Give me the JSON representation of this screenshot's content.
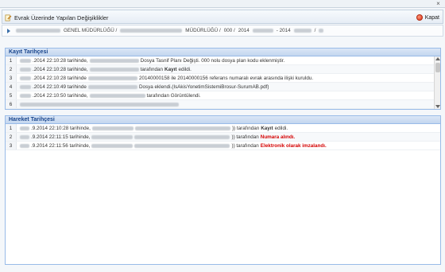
{
  "window": {
    "close_glyph": "×"
  },
  "toolbar": {
    "title": "Evrak Üzerinde Yapılan Değişiklikler",
    "close_label": "Kapat"
  },
  "breadcrumb": {
    "part1": "GENEL MÜDÜRLÜĞÜ /",
    "part2": "MÜDÜRLÜĞÜ /",
    "part3": "000 /",
    "part4": "2014",
    "part5": "- 2014",
    "part6": "/"
  },
  "kayit": {
    "header": "Kayıt Tarihçesi",
    "rows": [
      {
        "n": "1",
        "date": ".2014 22:10:28 tarihinde,",
        "rest": "Dosya Tasnif Planı Değişti. 000 nolu dosya plan kodu eklenmiştir."
      },
      {
        "n": "2",
        "date": ".2014 22:10:28 tarihinde,",
        "pre": "tarafından",
        "bold": "Kayıt",
        "post": "edildi."
      },
      {
        "n": "3",
        "date": ".2014 22:10:28 tarihinde",
        "rest": "20140000158 ile 20140000156 referans numaralı evrak arasında ilişki kuruldu."
      },
      {
        "n": "4",
        "date": ".2014 22:10:49 tarihinde",
        "rest": "Dosya eklendi.(IsAkisYonetimSistemiBrosur-SurumAB.pdf)"
      },
      {
        "n": "5",
        "date": ".2014 22:10:50 tarihinde,",
        "rest": "tarafından Görüntülendi."
      },
      {
        "n": "6",
        "date": "",
        "rest": ""
      }
    ]
  },
  "hareket": {
    "header": "Hareket Tarihçesi",
    "rows": [
      {
        "n": "1",
        "date": ".9.2014 22:10:28 tarihinde,",
        "mid": ")) tarafından",
        "hl": "Kayıt",
        "end": "edildi.",
        "red": false
      },
      {
        "n": "2",
        "date": ".9.2014 22:11:15 tarihinde,",
        "mid": ")) tarafından",
        "hl": "Numara alındı.",
        "end": "",
        "red": true
      },
      {
        "n": "3",
        "date": ".9.2014 22:11:56 tarihinde,",
        "mid": ")) tarafından",
        "hl": "Elektronik olarak imzalandı.",
        "end": "",
        "red": true
      }
    ]
  }
}
